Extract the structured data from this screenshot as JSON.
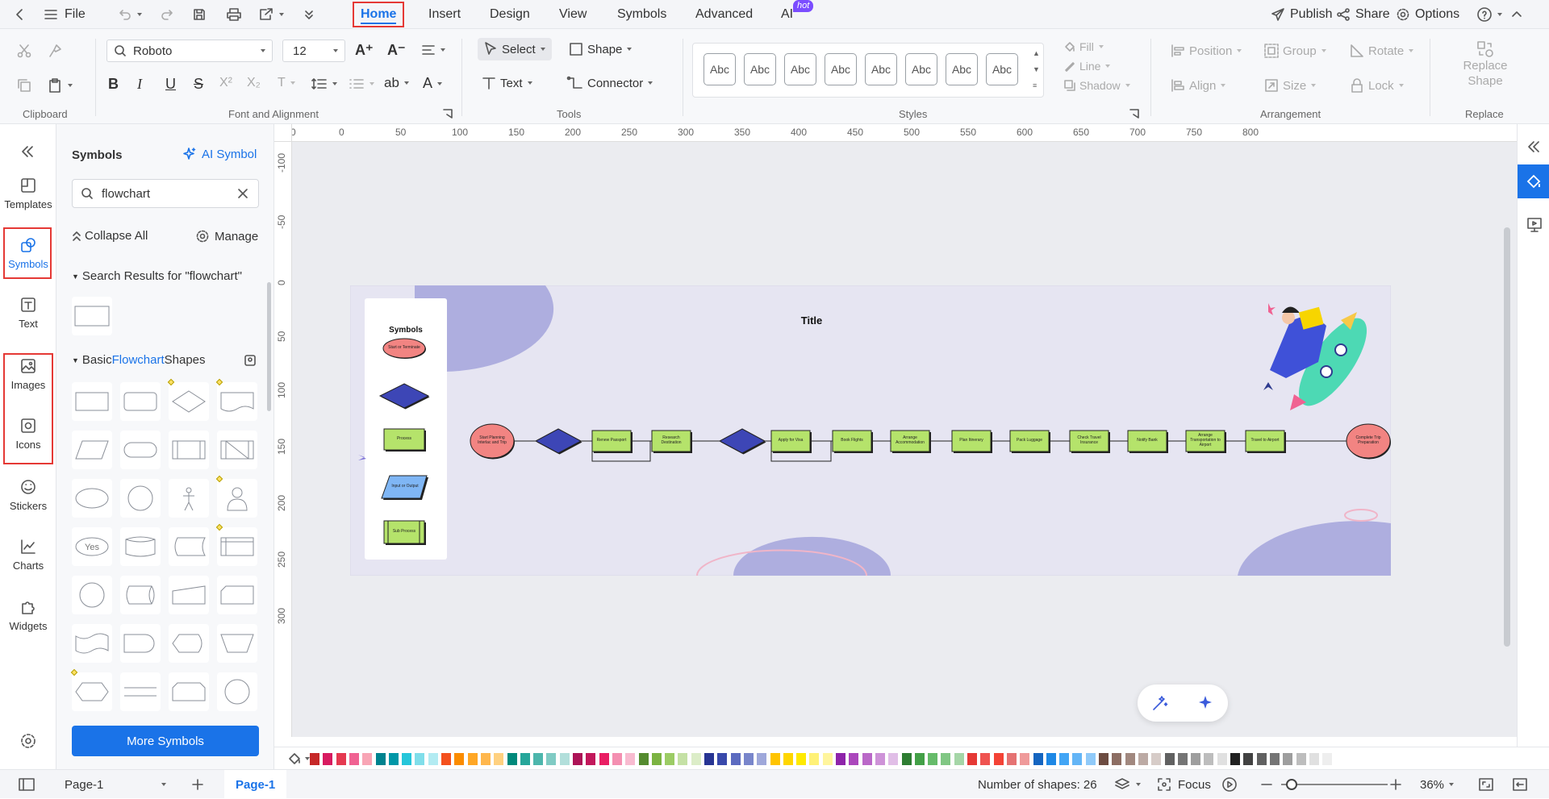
{
  "topbar": {
    "file_label": "File",
    "menu_tabs": [
      "Home",
      "Insert",
      "Design",
      "View",
      "Symbols",
      "Advanced",
      "AI"
    ],
    "hot_badge": "hot",
    "publish": "Publish",
    "share": "Share",
    "options": "Options"
  },
  "ribbon": {
    "groups": [
      "Clipboard",
      "Font and Alignment",
      "Tools",
      "Styles",
      "Arrangement",
      "Replace"
    ],
    "font_family": "Roboto",
    "font_size": "12",
    "select": "Select",
    "shape": "Shape",
    "text": "Text",
    "connector": "Connector",
    "style_samples": [
      "Abc",
      "Abc",
      "Abc",
      "Abc",
      "Abc",
      "Abc",
      "Abc",
      "Abc"
    ],
    "fill": "Fill",
    "line": "Line",
    "shadow": "Shadow",
    "position": "Position",
    "group": "Group",
    "rotate": "Rotate",
    "align": "Align",
    "size": "Size",
    "lock": "Lock",
    "replace_line1": "Replace",
    "replace_line2": "Shape"
  },
  "leftrail": {
    "items": [
      "Templates",
      "Symbols",
      "Text",
      "Images",
      "Icons",
      "Stickers",
      "Charts",
      "Widgets"
    ]
  },
  "panel": {
    "title": "Symbols",
    "ai_symbol": "AI Symbol",
    "search_value": "flowchart",
    "collapse_all": "Collapse All",
    "manage": "Manage",
    "search_results_prefix": "Search Results for ",
    "search_results_term": "\"flowchart\"",
    "section_pre": "Basic ",
    "section_hl": "Flowchart",
    "section_post": " Shapes",
    "yes_label": "Yes",
    "more_symbols": "More Symbols"
  },
  "ruler": {
    "h_ticks": [
      "0",
      "0",
      "50",
      "100",
      "150",
      "200",
      "250",
      "300",
      "350",
      "400",
      "450",
      "500",
      "550",
      "600",
      "650",
      "700",
      "750",
      "800"
    ],
    "v_ticks": [
      "-100",
      "-50",
      "0",
      "50",
      "100",
      "150",
      "200",
      "250",
      "300"
    ]
  },
  "diagram": {
    "title": "Title",
    "legend_title": "Symbols",
    "legend_items": [
      "Start or Terminate",
      "",
      "Process",
      "Input or Output",
      "Sub Process"
    ],
    "start": "Start Planning Interlac and Trip",
    "steps": [
      "Renew Passport",
      "Research Destination",
      "Apply for Visa",
      "Book Flights",
      "Arrange Accommodation",
      "Plan Itinerary",
      "Pack Luggage",
      "Check Travel Insurance",
      "Notify Bank",
      "Arrange Transportation to Airport",
      "Travel to Airport"
    ],
    "end": "Complete Trip Preparation"
  },
  "colors": {
    "accent": "#1a73e8",
    "highlight_border": "#e53935",
    "terminal": "#f28482",
    "process": "#b5e36b",
    "decision": "#3d46b6",
    "io": "#7fb6f5",
    "backdrop": "#e6e5f2",
    "blob": "#aeaedf"
  },
  "palette": [
    "#c62828",
    "#d81b60",
    "#e53950",
    "#f06292",
    "#f8a5b5",
    "#00838f",
    "#0097a7",
    "#26c6da",
    "#80deea",
    "#b2ebf2",
    "#f4511e",
    "#fb8c00",
    "#ffa726",
    "#ffb74d",
    "#ffd180",
    "#00897b",
    "#26a69a",
    "#4db6ac",
    "#80cbc4",
    "#b2dfdb",
    "#ad1457",
    "#c2185b",
    "#e91e63",
    "#f48fb1",
    "#f8bbd0",
    "#558b2f",
    "#7cb342",
    "#9ccc65",
    "#c5e1a5",
    "#dcedc8",
    "#283593",
    "#3949ab",
    "#5c6bc0",
    "#7986cb",
    "#9fa8da",
    "#ffc400",
    "#ffd600",
    "#ffea00",
    "#fff176",
    "#fff59d",
    "#8e24aa",
    "#ab47bc",
    "#ba68c8",
    "#ce93d8",
    "#e1bee7",
    "#2e7d32",
    "#43a047",
    "#66bb6a",
    "#81c784",
    "#a5d6a7",
    "#e53935",
    "#ef5350",
    "#f44336",
    "#e57373",
    "#ef9a9a",
    "#1565c0",
    "#1e88e5",
    "#42a5f5",
    "#64b5f6",
    "#90caf9",
    "#6d4c41",
    "#8d6e63",
    "#a1887f",
    "#bcaaa4",
    "#d7ccc8",
    "#616161",
    "#757575",
    "#9e9e9e",
    "#bdbdbd",
    "#e0e0e0",
    "#212121",
    "#424242",
    "#616161",
    "#757575",
    "#9e9e9e",
    "#bdbdbd",
    "#e0e0e0",
    "#eeeeee"
  ],
  "status": {
    "page_selector": "Page-1",
    "page_tab": "Page-1",
    "shape_count": "Number of shapes: 26",
    "focus": "Focus",
    "zoom": "36%"
  }
}
